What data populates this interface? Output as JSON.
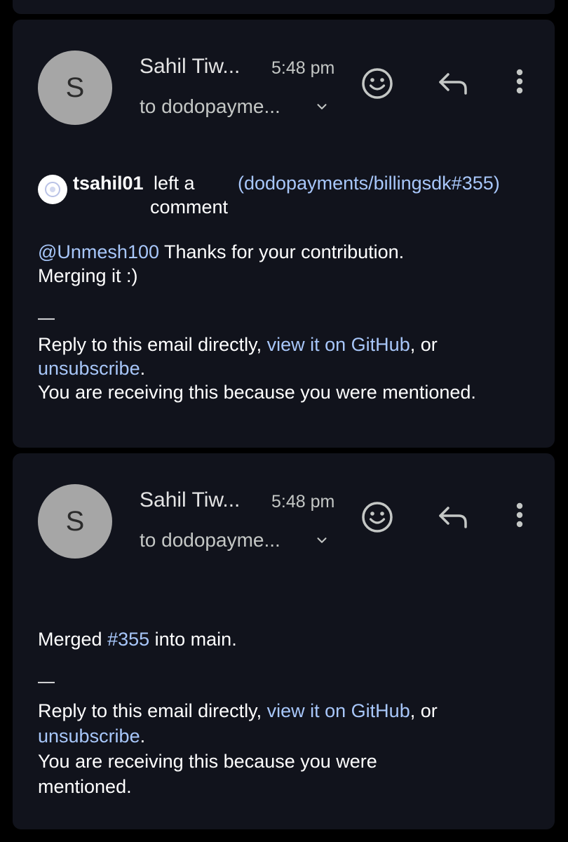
{
  "messages": [
    {
      "avatar_letter": "S",
      "sender": "Sahil Tiw...",
      "time": "5:48 pm",
      "recipient": "to dodopayme...",
      "github_user": "tsahil01",
      "action_line1": "left a",
      "action_line2": "comment",
      "repo_ref": "(dodopayments/billingsdk#355)",
      "mention": "@Unmesh100",
      "text1": " Thanks for your contribution.",
      "text2": "Merging it :)",
      "separator": "—",
      "footer_prefix": "Reply to this email directly, ",
      "footer_link1": "view it on GitHub",
      "footer_mid": ", or",
      "footer_link2": "unsubscribe",
      "footer_end": ".",
      "footer_reason": "You are receiving this because you were mentioned."
    },
    {
      "avatar_letter": "S",
      "sender": "Sahil Tiw...",
      "time": "5:48 pm",
      "recipient": "to dodopayme...",
      "merged_prefix": "Merged ",
      "merged_link": "#355",
      "merged_suffix": " into main.",
      "separator": "—",
      "footer_prefix": "Reply to this email directly, ",
      "footer_link1": "view it on GitHub",
      "footer_mid": ", or",
      "footer_link2": "unsubscribe",
      "footer_end": ".",
      "footer_reason_line1": "You are receiving this because you were",
      "footer_reason_line2": "mentioned."
    }
  ],
  "icons": {
    "emoji": "smiley-icon",
    "reply": "reply-arrow-icon",
    "more": "more-vert-icon",
    "expand": "chevron-down-icon"
  },
  "colors": {
    "background": "#000000",
    "card": "#11131c",
    "link": "#a8c7fa",
    "avatar": "#a6a6a6"
  }
}
